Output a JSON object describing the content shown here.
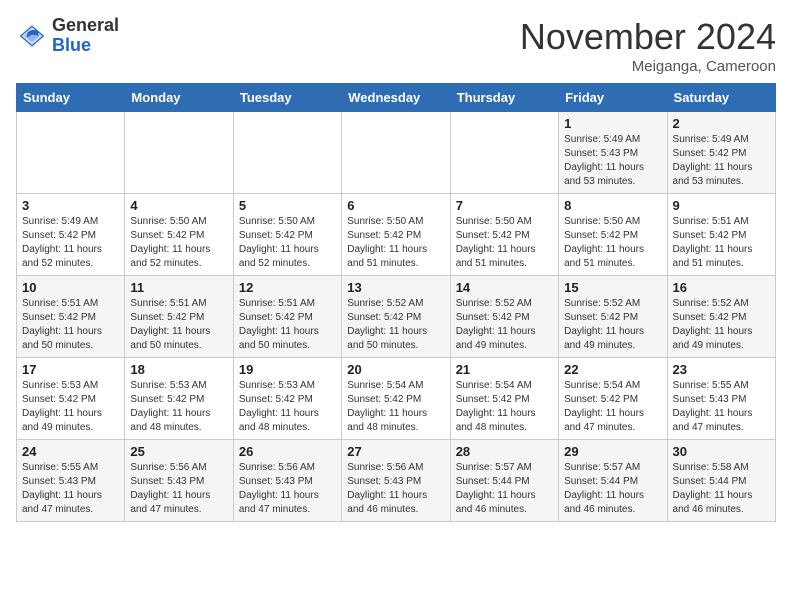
{
  "header": {
    "logo_general": "General",
    "logo_blue": "Blue",
    "month_title": "November 2024",
    "subtitle": "Meiganga, Cameroon"
  },
  "calendar": {
    "weekdays": [
      "Sunday",
      "Monday",
      "Tuesday",
      "Wednesday",
      "Thursday",
      "Friday",
      "Saturday"
    ],
    "weeks": [
      [
        {
          "day": "",
          "info": ""
        },
        {
          "day": "",
          "info": ""
        },
        {
          "day": "",
          "info": ""
        },
        {
          "day": "",
          "info": ""
        },
        {
          "day": "",
          "info": ""
        },
        {
          "day": "1",
          "info": "Sunrise: 5:49 AM\nSunset: 5:43 PM\nDaylight: 11 hours\nand 53 minutes."
        },
        {
          "day": "2",
          "info": "Sunrise: 5:49 AM\nSunset: 5:42 PM\nDaylight: 11 hours\nand 53 minutes."
        }
      ],
      [
        {
          "day": "3",
          "info": "Sunrise: 5:49 AM\nSunset: 5:42 PM\nDaylight: 11 hours\nand 52 minutes."
        },
        {
          "day": "4",
          "info": "Sunrise: 5:50 AM\nSunset: 5:42 PM\nDaylight: 11 hours\nand 52 minutes."
        },
        {
          "day": "5",
          "info": "Sunrise: 5:50 AM\nSunset: 5:42 PM\nDaylight: 11 hours\nand 52 minutes."
        },
        {
          "day": "6",
          "info": "Sunrise: 5:50 AM\nSunset: 5:42 PM\nDaylight: 11 hours\nand 51 minutes."
        },
        {
          "day": "7",
          "info": "Sunrise: 5:50 AM\nSunset: 5:42 PM\nDaylight: 11 hours\nand 51 minutes."
        },
        {
          "day": "8",
          "info": "Sunrise: 5:50 AM\nSunset: 5:42 PM\nDaylight: 11 hours\nand 51 minutes."
        },
        {
          "day": "9",
          "info": "Sunrise: 5:51 AM\nSunset: 5:42 PM\nDaylight: 11 hours\nand 51 minutes."
        }
      ],
      [
        {
          "day": "10",
          "info": "Sunrise: 5:51 AM\nSunset: 5:42 PM\nDaylight: 11 hours\nand 50 minutes."
        },
        {
          "day": "11",
          "info": "Sunrise: 5:51 AM\nSunset: 5:42 PM\nDaylight: 11 hours\nand 50 minutes."
        },
        {
          "day": "12",
          "info": "Sunrise: 5:51 AM\nSunset: 5:42 PM\nDaylight: 11 hours\nand 50 minutes."
        },
        {
          "day": "13",
          "info": "Sunrise: 5:52 AM\nSunset: 5:42 PM\nDaylight: 11 hours\nand 50 minutes."
        },
        {
          "day": "14",
          "info": "Sunrise: 5:52 AM\nSunset: 5:42 PM\nDaylight: 11 hours\nand 49 minutes."
        },
        {
          "day": "15",
          "info": "Sunrise: 5:52 AM\nSunset: 5:42 PM\nDaylight: 11 hours\nand 49 minutes."
        },
        {
          "day": "16",
          "info": "Sunrise: 5:52 AM\nSunset: 5:42 PM\nDaylight: 11 hours\nand 49 minutes."
        }
      ],
      [
        {
          "day": "17",
          "info": "Sunrise: 5:53 AM\nSunset: 5:42 PM\nDaylight: 11 hours\nand 49 minutes."
        },
        {
          "day": "18",
          "info": "Sunrise: 5:53 AM\nSunset: 5:42 PM\nDaylight: 11 hours\nand 48 minutes."
        },
        {
          "day": "19",
          "info": "Sunrise: 5:53 AM\nSunset: 5:42 PM\nDaylight: 11 hours\nand 48 minutes."
        },
        {
          "day": "20",
          "info": "Sunrise: 5:54 AM\nSunset: 5:42 PM\nDaylight: 11 hours\nand 48 minutes."
        },
        {
          "day": "21",
          "info": "Sunrise: 5:54 AM\nSunset: 5:42 PM\nDaylight: 11 hours\nand 48 minutes."
        },
        {
          "day": "22",
          "info": "Sunrise: 5:54 AM\nSunset: 5:42 PM\nDaylight: 11 hours\nand 47 minutes."
        },
        {
          "day": "23",
          "info": "Sunrise: 5:55 AM\nSunset: 5:43 PM\nDaylight: 11 hours\nand 47 minutes."
        }
      ],
      [
        {
          "day": "24",
          "info": "Sunrise: 5:55 AM\nSunset: 5:43 PM\nDaylight: 11 hours\nand 47 minutes."
        },
        {
          "day": "25",
          "info": "Sunrise: 5:56 AM\nSunset: 5:43 PM\nDaylight: 11 hours\nand 47 minutes."
        },
        {
          "day": "26",
          "info": "Sunrise: 5:56 AM\nSunset: 5:43 PM\nDaylight: 11 hours\nand 47 minutes."
        },
        {
          "day": "27",
          "info": "Sunrise: 5:56 AM\nSunset: 5:43 PM\nDaylight: 11 hours\nand 46 minutes."
        },
        {
          "day": "28",
          "info": "Sunrise: 5:57 AM\nSunset: 5:44 PM\nDaylight: 11 hours\nand 46 minutes."
        },
        {
          "day": "29",
          "info": "Sunrise: 5:57 AM\nSunset: 5:44 PM\nDaylight: 11 hours\nand 46 minutes."
        },
        {
          "day": "30",
          "info": "Sunrise: 5:58 AM\nSunset: 5:44 PM\nDaylight: 11 hours\nand 46 minutes."
        }
      ]
    ]
  }
}
